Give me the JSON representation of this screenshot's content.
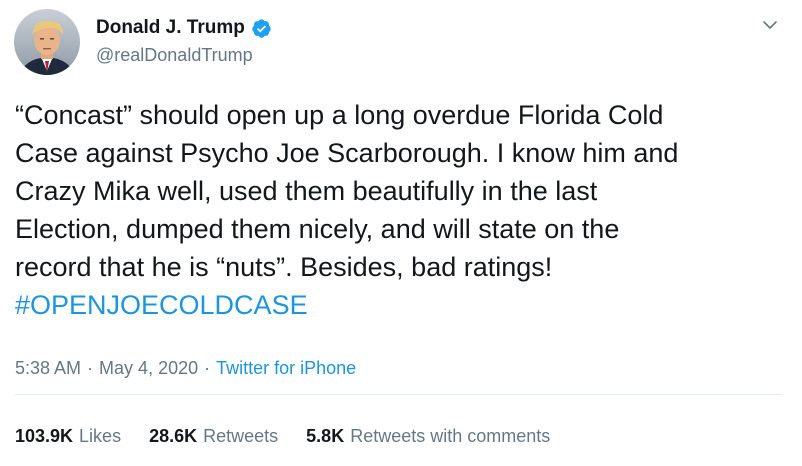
{
  "author": {
    "display_name": "Donald J. Trump",
    "handle": "@realDonaldTrump",
    "verified_icon": "verified-badge-icon",
    "avatar_icon": "profile-photo"
  },
  "tweet": {
    "lines": [
      "“Concast” should open up a long overdue Florida Cold",
      "Case against Psycho Joe Scarborough. I know him and",
      "Crazy Mika well, used them beautifully in the last",
      "Election, dumped them nicely, and will state on the",
      "record that he is “nuts”. Besides, bad ratings!"
    ],
    "hashtag": "#OPENJOECOLDCASE"
  },
  "meta": {
    "time": "5:38 AM",
    "separator": "·",
    "date": "May 4, 2020",
    "source": "Twitter for iPhone"
  },
  "stats": {
    "likes_count": "103.9K",
    "likes_label": "Likes",
    "retweets_count": "28.6K",
    "retweets_label": "Retweets",
    "comments_count": "5.8K",
    "comments_label": "Retweets with comments"
  },
  "colors": {
    "text": "#14171a",
    "secondary": "#657786",
    "link": "#1b95e0",
    "divider": "#e6ecf0",
    "verified": "#1da1f2"
  }
}
